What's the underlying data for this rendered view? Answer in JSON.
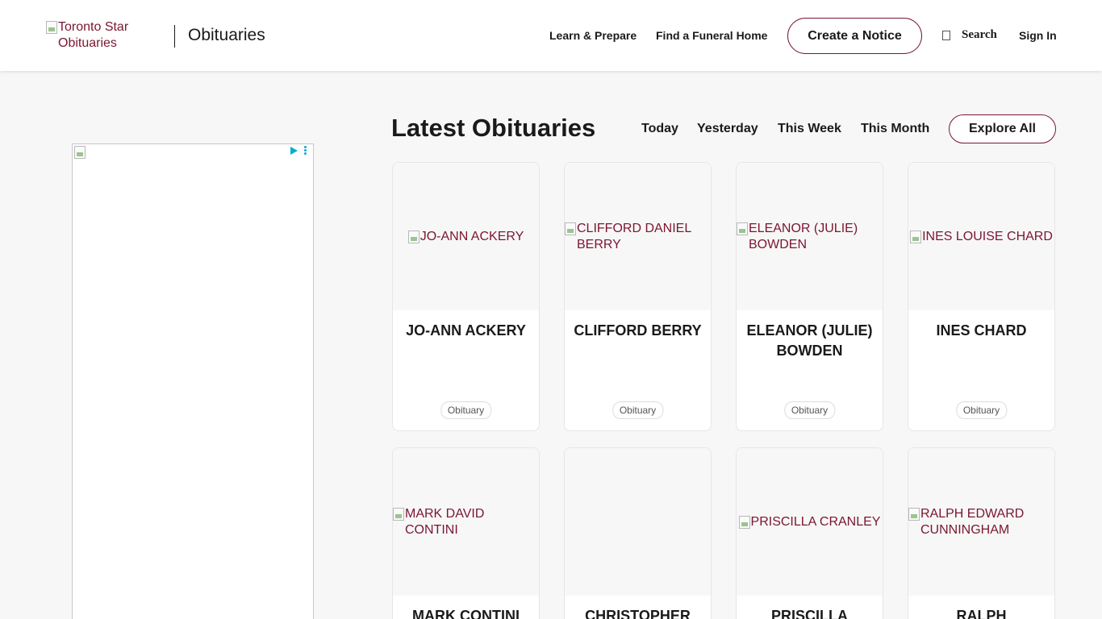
{
  "header": {
    "logo_alt": "Toronto Star Obituaries",
    "section_title": "Obituaries",
    "nav": {
      "learn": "Learn & Prepare",
      "funeral": "Find a Funeral Home",
      "create": "Create a Notice",
      "search": "Search",
      "signin": "Sign In"
    }
  },
  "main": {
    "title": "Latest Obituaries",
    "filters": {
      "today": "Today",
      "yesterday": "Yesterday",
      "week": "This Week",
      "month": "This Month"
    },
    "explore": "Explore All",
    "cards": [
      {
        "alt": "JO-ANN ACKERY",
        "name": "JO-ANN ACKERY",
        "badge": "Obituary"
      },
      {
        "alt": "CLIFFORD DANIEL BERRY",
        "name": "CLIFFORD BERRY",
        "badge": "Obituary"
      },
      {
        "alt": "ELEANOR (JULIE) BOWDEN",
        "name": "ELEANOR (JULIE) BOWDEN",
        "badge": "Obituary"
      },
      {
        "alt": "INES LOUISE CHARD",
        "name": "INES CHARD",
        "badge": "Obituary"
      },
      {
        "alt": "MARK DAVID CONTINI",
        "name": "MARK CONTINI"
      },
      {
        "name": "CHRISTOPHER"
      },
      {
        "alt": "PRISCILLA CRANLEY",
        "name": "PRISCILLA"
      },
      {
        "alt": "RALPH EDWARD CUNNINGHAM",
        "name": "RALPH"
      }
    ]
  },
  "colors": {
    "accent": "#7a1631",
    "page_bg": "#f7f7f7",
    "ad_choices": "#00aecd"
  }
}
